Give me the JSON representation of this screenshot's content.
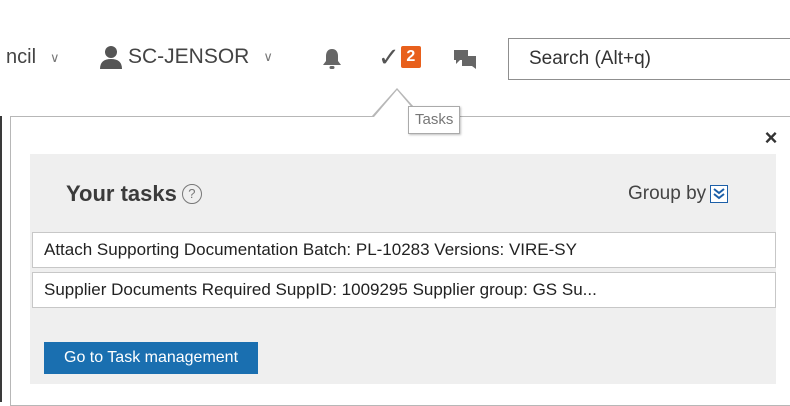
{
  "header": {
    "council_label": "ncil",
    "user_label": "SC-JENSOR",
    "tasks_badge": "2",
    "tasks_tooltip": "Tasks",
    "search_placeholder": "Search (Alt+q)",
    "close_label": "×"
  },
  "tasks_panel": {
    "title": "Your tasks",
    "help_icon_label": "?",
    "group_by_label": "Group by",
    "tasks": [
      {
        "label": "Attach Supporting Documentation Batch: PL-10283 Versions: VIRE-SY"
      },
      {
        "label": "Supplier Documents Required SuppID: 1009295 Supplier group: GS Su..."
      }
    ],
    "goto_button_label": "Go to Task management"
  },
  "colors": {
    "badge": "#e8601c",
    "primary_button": "#1a6fb0",
    "panel_bg": "#efefef"
  },
  "icons": [
    "chevron-down-icon",
    "user-icon",
    "bell-icon",
    "check-icon",
    "chat-icon",
    "close-icon",
    "help-icon",
    "group-by-icon"
  ]
}
